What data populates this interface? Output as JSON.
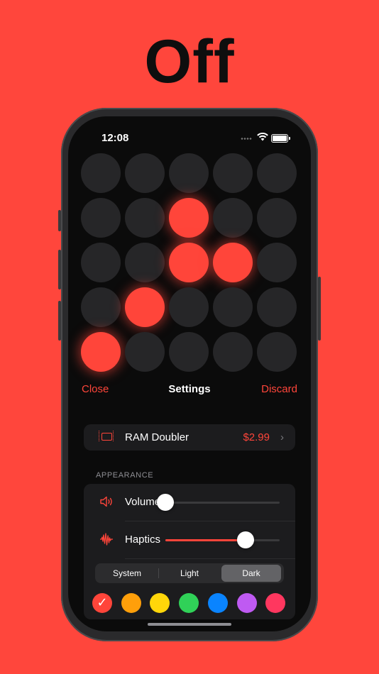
{
  "headline": "Off",
  "status_bar": {
    "time": "12:08"
  },
  "grid": {
    "rows": [
      [
        false,
        false,
        false,
        false,
        false
      ],
      [
        false,
        false,
        true,
        false,
        false
      ],
      [
        false,
        false,
        true,
        true,
        false
      ],
      [
        false,
        true,
        false,
        false,
        false
      ],
      [
        true,
        false,
        false,
        false,
        false
      ]
    ],
    "on_color": "#ff453a",
    "off_color": "#262628"
  },
  "nav": {
    "close_label": "Close",
    "title": "Settings",
    "discard_label": "Discard"
  },
  "purchase": {
    "icon": "memory-chip-icon",
    "label": "RAM Doubler",
    "price": "$2.99"
  },
  "appearance": {
    "header": "APPEARANCE",
    "volume": {
      "label": "Volume",
      "icon": "speaker-icon",
      "value": 0.0
    },
    "haptics": {
      "label": "Haptics",
      "icon": "waveform-icon",
      "value": 0.7
    },
    "theme": {
      "options": [
        "System",
        "Light",
        "Dark"
      ],
      "selected": "Dark"
    },
    "colors": [
      {
        "hex": "#ff453a",
        "selected": true
      },
      {
        "hex": "#ff9f0a",
        "selected": false
      },
      {
        "hex": "#ffd60a",
        "selected": false
      },
      {
        "hex": "#30d158",
        "selected": false
      },
      {
        "hex": "#0a84ff",
        "selected": false
      },
      {
        "hex": "#bf5af2",
        "selected": false
      },
      {
        "hex": "#ff375f",
        "selected": false
      }
    ]
  },
  "accent_color": "#ff453a",
  "background_color": "#ff463c"
}
